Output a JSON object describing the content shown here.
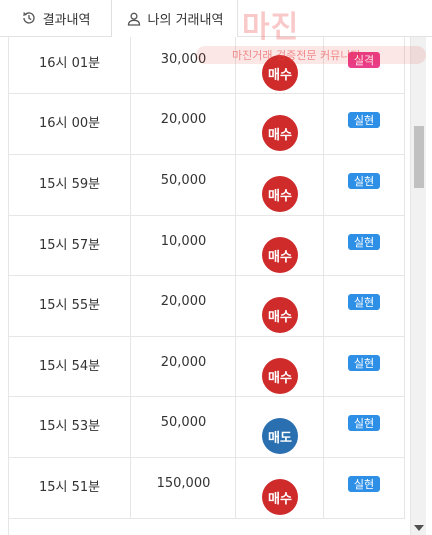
{
  "tabs": {
    "results_label": "결과내역",
    "mine_label": "나의 거래내역"
  },
  "watermark": {
    "brand": "마진",
    "tagline": "마진거래 검증전문 커뮤니티"
  },
  "colors": {
    "buy": "#cf2b2b",
    "sell": "#2a6fb0",
    "win_badge": "#2d8fe6",
    "lose_badge": "#ea3d8a"
  },
  "rows": [
    {
      "time": "16시 01분",
      "amount": "30,000",
      "side": "매수",
      "side_type": "buy",
      "result": "실격",
      "result_type": "lose"
    },
    {
      "time": "16시 00분",
      "amount": "20,000",
      "side": "매수",
      "side_type": "buy",
      "result": "실현",
      "result_type": "win"
    },
    {
      "time": "15시 59분",
      "amount": "50,000",
      "side": "매수",
      "side_type": "buy",
      "result": "실현",
      "result_type": "win"
    },
    {
      "time": "15시 57분",
      "amount": "10,000",
      "side": "매수",
      "side_type": "buy",
      "result": "실현",
      "result_type": "win"
    },
    {
      "time": "15시 55분",
      "amount": "20,000",
      "side": "매수",
      "side_type": "buy",
      "result": "실현",
      "result_type": "win"
    },
    {
      "time": "15시 54분",
      "amount": "20,000",
      "side": "매수",
      "side_type": "buy",
      "result": "실현",
      "result_type": "win"
    },
    {
      "time": "15시 53분",
      "amount": "50,000",
      "side": "매도",
      "side_type": "sell",
      "result": "실현",
      "result_type": "win"
    },
    {
      "time": "15시 51분",
      "amount": "150,000",
      "side": "매수",
      "side_type": "buy",
      "result": "실현",
      "result_type": "win"
    }
  ]
}
